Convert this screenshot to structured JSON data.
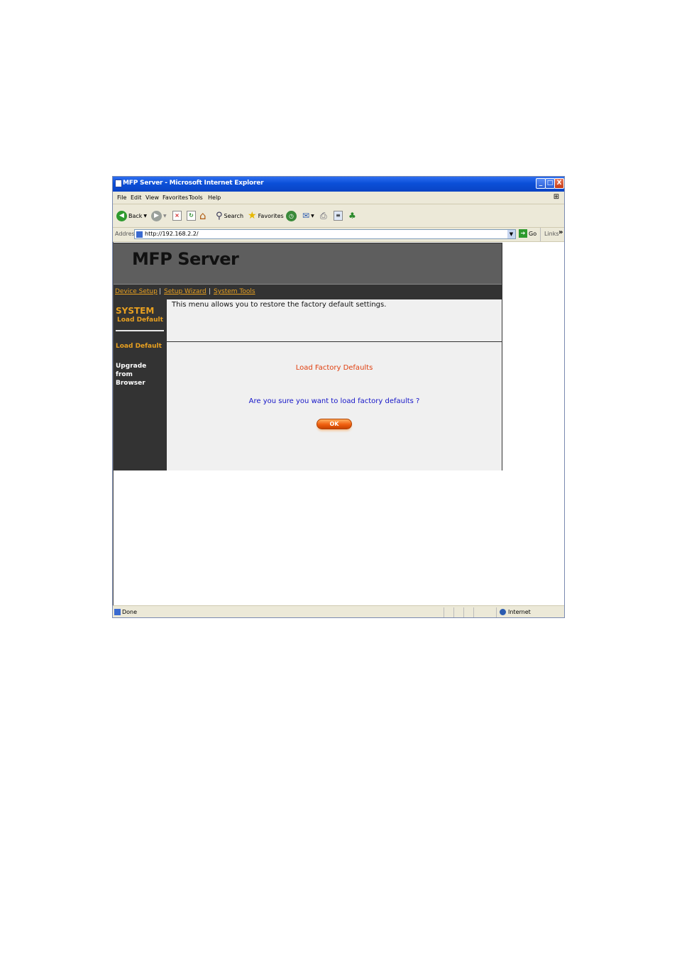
{
  "window": {
    "title": "MFP Server - Microsoft Internet Explorer",
    "buttons": {
      "minimize": "_",
      "maximize": "□",
      "close": "X"
    }
  },
  "menu": [
    "File",
    "Edit",
    "View",
    "Favorites",
    "Tools",
    "Help"
  ],
  "toolbar": {
    "back": "Back",
    "search": "Search",
    "favorites": "Favorites"
  },
  "address": {
    "label": "Address",
    "url": "http://192.168.2.2/",
    "go": "Go",
    "links": "Links",
    "more": "»"
  },
  "page": {
    "title": "MFP Server",
    "nav": [
      "Device Setup",
      "Setup Wizard",
      "System Tools"
    ],
    "nav_sep": "|",
    "sidebar": {
      "section": "SYSTEM",
      "section_sub": "Load Default",
      "items": [
        "Load Default",
        "Upgrade from Browser"
      ]
    },
    "info": "This menu allows you to restore the factory default settings.",
    "form": {
      "heading": "Load Factory Defaults",
      "question": "Are you sure you want to load factory defaults ?",
      "ok": "OK"
    }
  },
  "status": {
    "text": "Done",
    "zone": "Internet"
  },
  "colors": {
    "accent": "#e8a020",
    "heading_red": "#e04010",
    "question_blue": "#1515c8",
    "titlebar": "#0b4fd8"
  }
}
